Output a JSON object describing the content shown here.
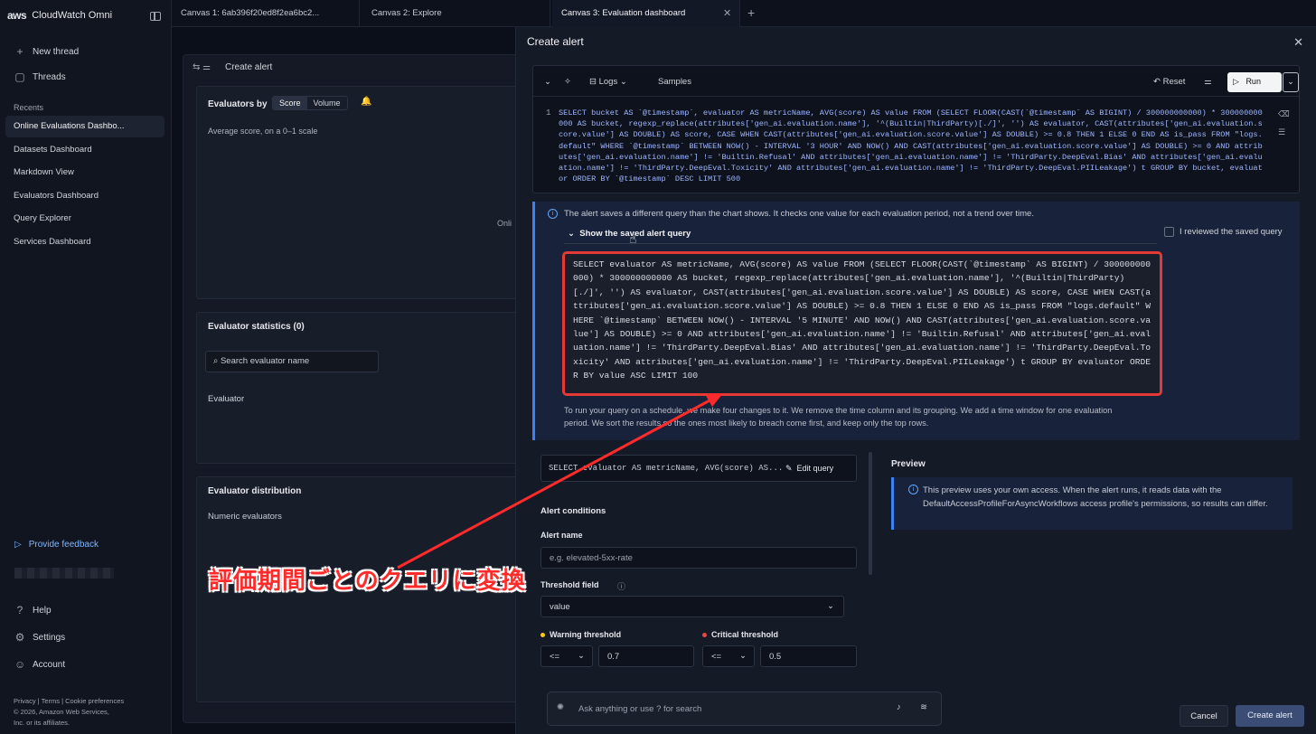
{
  "sidebar": {
    "brand": "CloudWatch Omni",
    "aws": "aws",
    "new_thread": "New thread",
    "threads": "Threads",
    "recents_header": "Recents",
    "recents": [
      "Online Evaluations Dashbo...",
      "Datasets Dashboard",
      "Markdown View",
      "Evaluators Dashboard",
      "Query Explorer",
      "Services Dashboard"
    ],
    "feedback": "Provide feedback",
    "help": "Help",
    "settings": "Settings",
    "account": "Account",
    "footer_links": "Privacy  |  Terms  |  Cookie preferences",
    "footer_copy": "© 2026, Amazon Web Services,",
    "footer_copy2": "Inc. or its affiliates."
  },
  "tabs": [
    "Canvas 1: 6ab396f20ed8f2ea6bc2...",
    "Canvas 2: Explore",
    "Canvas 3: Evaluation dashboard"
  ],
  "dashboard": {
    "title": "Create alert",
    "evaluators_by": "Evaluators by",
    "seg_score": "Score",
    "seg_volume": "Volume",
    "avg_score": "Average score, on a 0–1 scale",
    "stats_title": "Evaluator statistics (0)",
    "search_placeholder": "Search evaluator name",
    "evaluator_col": "Evaluator",
    "dist_title": "Evaluator distribution",
    "numeric": "Numeric evaluators",
    "mid_text": "Onli"
  },
  "modal": {
    "title": "Create alert",
    "logs": "Logs",
    "samples": "Samples",
    "reset": "Reset",
    "run": "Run",
    "line_no": "1",
    "query": "SELECT bucket AS `@timestamp`, evaluator AS metricName, AVG(score) AS value FROM (SELECT FLOOR(CAST(`@timestamp` AS BIGINT) / 300000000000) * 300000000000 AS bucket, regexp_replace(attributes['gen_ai.evaluation.name'], '^(Builtin|ThirdParty)[./]', '') AS evaluator, CAST(attributes['gen_ai.evaluation.score.value'] AS DOUBLE) AS score, CASE WHEN CAST(attributes['gen_ai.evaluation.score.value'] AS DOUBLE) >= 0.8 THEN 1 ELSE 0 END AS is_pass FROM \"logs.default\" WHERE `@timestamp` BETWEEN NOW() - INTERVAL '3 HOUR' AND NOW() AND CAST(attributes['gen_ai.evaluation.score.value'] AS DOUBLE) >= 0 AND attributes['gen_ai.evaluation.name'] != 'Builtin.Refusal' AND attributes['gen_ai.evaluation.name'] != 'ThirdParty.DeepEval.Bias' AND attributes['gen_ai.evaluation.name'] != 'ThirdParty.DeepEval.Toxicity' AND attributes['gen_ai.evaluation.name'] != 'ThirdParty.DeepEval.PIILeakage') t GROUP BY bucket, evaluator ORDER BY `@timestamp` DESC LIMIT 500",
    "info_msg": "The alert saves a different query than the chart shows. It checks one value for each evaluation period, not a trend over time.",
    "show_saved": "Show the saved alert query",
    "reviewed": "I reviewed the saved query",
    "saved_query": "SELECT evaluator AS metricName, AVG(score) AS value FROM (SELECT FLOOR(CAST(`@timestamp` AS BIGINT) / 300000000000) * 300000000000 AS bucket, regexp_replace(attributes['gen_ai.evaluation.name'], '^(Builtin|ThirdParty)[./]', '') AS evaluator, CAST(attributes['gen_ai.evaluation.score.value'] AS DOUBLE) AS score, CASE WHEN CAST(attributes['gen_ai.evaluation.score.value'] AS DOUBLE) >= 0.8 THEN 1 ELSE 0 END AS is_pass FROM \"logs.default\" WHERE `@timestamp` BETWEEN NOW() - INTERVAL '5 MINUTE' AND NOW() AND CAST(attributes['gen_ai.evaluation.score.value'] AS DOUBLE) >= 0 AND attributes['gen_ai.evaluation.name'] != 'Builtin.Refusal' AND attributes['gen_ai.evaluation.name'] != 'ThirdParty.DeepEval.Bias' AND attributes['gen_ai.evaluation.name'] != 'ThirdParty.DeepEval.Toxicity' AND attributes['gen_ai.evaluation.name'] != 'ThirdParty.DeepEval.PIILeakage') t GROUP BY evaluator ORDER BY value ASC LIMIT 100",
    "explain": "To run your query on a schedule, we make four changes to it. We remove the time column and its grouping. We add a time window for one evaluation period. We sort the results so the ones most likely to breach come first, and keep only the top rows.",
    "query_preview": "SELECT evaluator AS metricName, AVG(score) AS...",
    "edit_query": "Edit query",
    "alert_conditions": "Alert conditions",
    "alert_name_label": "Alert name",
    "alert_name_placeholder": "e.g. elevated-5xx-rate",
    "threshold_label": "Threshold field",
    "threshold_value": "value",
    "warning_label": "Warning threshold",
    "warning_op": "<=",
    "warning_value": "0.7",
    "critical_label": "Critical threshold",
    "critical_op": "<=",
    "critical_value": "0.5",
    "preview_title": "Preview",
    "preview_msg": "This preview uses your own access. When the alert runs, it reads data with the DefaultAccessProfileForAsyncWorkflows access profile's permissions, so results can differ.",
    "ask_placeholder": "Ask anything or use  ? for search",
    "cancel": "Cancel",
    "create": "Create alert"
  },
  "annotation": {
    "text": "評価期間ごとのクエリに変換",
    "color": "#ff2b2b"
  }
}
